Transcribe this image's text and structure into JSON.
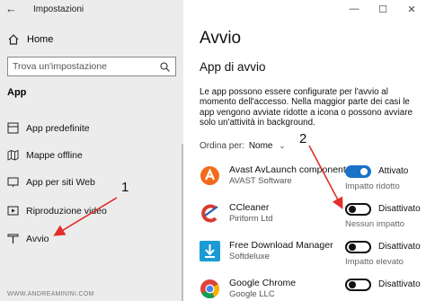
{
  "window": {
    "title": "Impostazioni",
    "controls": [
      "—",
      "☐",
      "✕"
    ]
  },
  "sidebar": {
    "home_label": "Home",
    "search_placeholder": "Trova un'impostazione",
    "section_label": "App",
    "items": [
      {
        "label": "App predefinite",
        "icon": "default-apps-icon"
      },
      {
        "label": "Mappe offline",
        "icon": "offline-maps-icon"
      },
      {
        "label": "App per siti Web",
        "icon": "apps-for-websites-icon"
      },
      {
        "label": "Riproduzione video",
        "icon": "video-playback-icon"
      },
      {
        "label": "Avvio",
        "icon": "startup-icon"
      }
    ]
  },
  "main": {
    "title": "Avvio",
    "subtitle": "App di avvio",
    "description": "Le app possono essere configurate per l'avvio al momento dell'accesso. Nella maggior parte dei casi le app vengono avviate ridotte a icona o possono avviare solo un'attività in background.",
    "sort_label": "Ordina per:",
    "sort_value": "Nome",
    "apps": [
      {
        "name": "Avast AvLaunch component",
        "publisher": "AVAST Software",
        "state": "Attivato",
        "on": true,
        "impact": "Impatto ridotto",
        "icon": "avast-icon"
      },
      {
        "name": "CCleaner",
        "publisher": "Piriform Ltd",
        "state": "Disattivato",
        "on": false,
        "impact": "Nessun impatto",
        "icon": "ccleaner-icon"
      },
      {
        "name": "Free Download Manager",
        "publisher": "Softdeluxe",
        "state": "Disattivato",
        "on": false,
        "impact": "Impatto elevato",
        "icon": "free-download-manager-icon"
      },
      {
        "name": "Google Chrome",
        "publisher": "Google LLC",
        "state": "Disattivato",
        "on": false,
        "impact": "",
        "icon": "google-chrome-icon"
      }
    ]
  },
  "annotations": {
    "label_1": "1",
    "label_2": "2",
    "arrow_color": "#e0302b"
  },
  "watermark": "WWW.ANDREAMININI.COM",
  "colors": {
    "accent": "#1a73c7",
    "sidebar_bg": "#ececec"
  }
}
